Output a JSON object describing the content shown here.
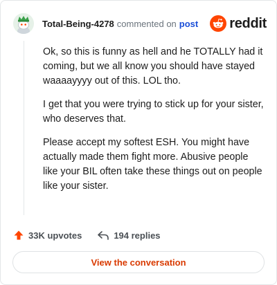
{
  "header": {
    "username": "Total-Being-4278",
    "action_text": "commented on",
    "post_link": "post",
    "brand_word": "reddit",
    "avatar_icon": "snoo-avatar-icon",
    "brand_icon": "reddit-logo-icon"
  },
  "comment": {
    "paragraphs": [
      "Ok, so this is funny as hell and he TOTALLY had it coming, but we all know you should have stayed waaaayyyy out of this. LOL tho.",
      "I get that you were trying to stick up for your sister, who deserves that.",
      "Please accept my softest ESH. You might have actually made them fight more. Abusive people like your BIL often take these things out on people like your sister."
    ]
  },
  "actions": {
    "upvotes": "33K upvotes",
    "replies": "194 replies",
    "upvote_icon": "upvote-arrow-icon",
    "reply_icon": "reply-arrow-icon"
  },
  "cta": {
    "label": "View the conversation"
  },
  "colors": {
    "accent": "#d93a00",
    "brand": "#ff4500",
    "link": "#1a4ed8",
    "muted": "#6a737c"
  }
}
